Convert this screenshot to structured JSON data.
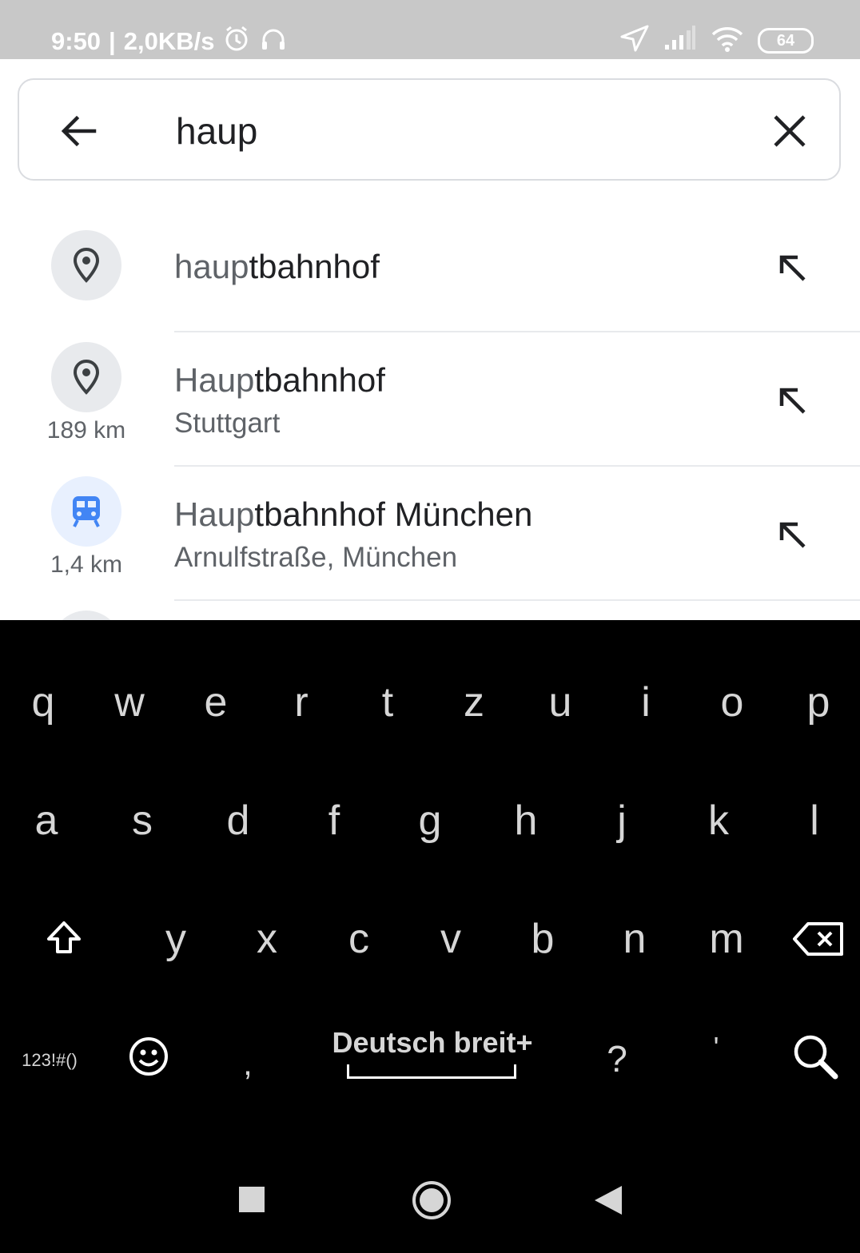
{
  "status": {
    "time": "9:50",
    "speed": "2,0KB/s",
    "battery": "64"
  },
  "search": {
    "query": "haup"
  },
  "suggestions": [
    {
      "typed": "haup",
      "rest": "tbahnhof",
      "subtitle": "",
      "distance": ""
    },
    {
      "typed": "Haup",
      "rest": "tbahnhof",
      "subtitle": "Stuttgart",
      "distance": "189 km"
    },
    {
      "typed": "Haup",
      "rest": "tbahnhof München",
      "subtitle": "Arnulfstraße, München",
      "distance": "1,4 km"
    }
  ],
  "keyboard": {
    "row1": [
      "q",
      "w",
      "e",
      "r",
      "t",
      "z",
      "u",
      "i",
      "o",
      "p"
    ],
    "row2": [
      "a",
      "s",
      "d",
      "f",
      "g",
      "h",
      "j",
      "k",
      "l"
    ],
    "row3": [
      "y",
      "x",
      "c",
      "v",
      "b",
      "n",
      "m"
    ],
    "symbols_label": "123!#()",
    "comma": ",",
    "space_label": "Deutsch breit+",
    "question": "?",
    "apostrophe": "'"
  },
  "colors": {
    "status_bg": "#c8c8c8",
    "transit_blue": "#4285f4",
    "keyboard_bg": "#000000"
  }
}
